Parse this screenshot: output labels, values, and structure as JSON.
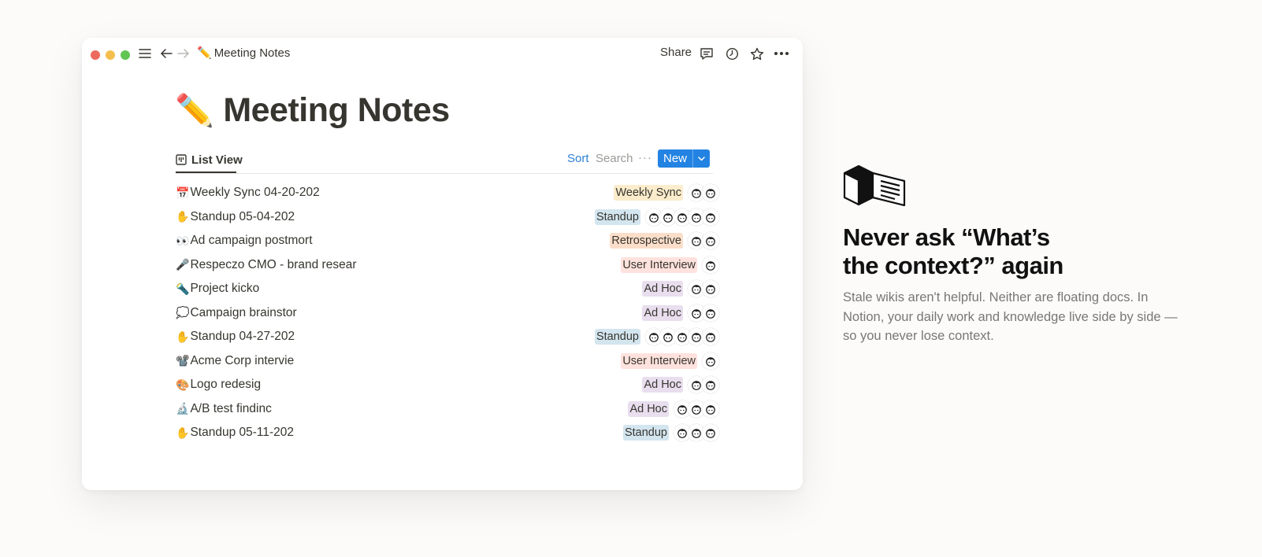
{
  "window": {
    "breadcrumb_emoji": "✏️",
    "breadcrumb_title": "Meeting Notes",
    "share_label": "Share",
    "icons": [
      "menu-icon",
      "back-arrow-icon",
      "forward-arrow-icon",
      "comment-icon",
      "history-icon",
      "star-icon",
      "more-icon"
    ]
  },
  "page": {
    "title_emoji": "✏️",
    "title": "Meeting Notes",
    "view_label": "List View",
    "sort_label": "Sort",
    "search_label": "Search",
    "more_label": "···",
    "new_label": "New"
  },
  "tag_colors": {
    "Weekly Sync": "#fbeccb",
    "Standup": "#d3e5ef",
    "Retrospective": "#fadec9",
    "User Interview": "#ffe2dd",
    "Ad Hoc": "#e8deee"
  },
  "rows": [
    {
      "emoji": "📅",
      "name": "Weekly Sync 04-20-202",
      "tag": "Weekly Sync",
      "avatars": 2
    },
    {
      "emoji": "✋",
      "name": "Standup 05-04-202",
      "tag": "Standup",
      "avatars": 5
    },
    {
      "emoji": "👀",
      "name": "Ad campaign postmort",
      "tag": "Retrospective",
      "avatars": 2
    },
    {
      "emoji": "🎤",
      "name": "Respeczo CMO - brand resear",
      "tag": "User Interview",
      "avatars": 1
    },
    {
      "emoji": "🔦",
      "name": "Project kicko",
      "tag": "Ad Hoc",
      "avatars": 2
    },
    {
      "emoji": "💭",
      "name": "Campaign brainstor",
      "tag": "Ad Hoc",
      "avatars": 2
    },
    {
      "emoji": "✋",
      "name": "Standup 04-27-202",
      "tag": "Standup",
      "avatars": 5
    },
    {
      "emoji": "📽️",
      "name": "Acme Corp intervie",
      "tag": "User Interview",
      "avatars": 1
    },
    {
      "emoji": "🎨",
      "name": "Logo redesig",
      "tag": "Ad Hoc",
      "avatars": 2
    },
    {
      "emoji": "🔬",
      "name": "A/B test findinc",
      "tag": "Ad Hoc",
      "avatars": 3
    },
    {
      "emoji": "✋",
      "name": "Standup 05-11-202",
      "tag": "Standup",
      "avatars": 3
    }
  ],
  "marketing": {
    "icon": "open-book-icon",
    "headline_line1": "Never ask “What’s",
    "headline_line2": "the context?” again",
    "body": "Stale wikis aren't helpful. Neither are floating docs. In Notion, your daily work and knowledge live side by side — so you never lose context."
  }
}
